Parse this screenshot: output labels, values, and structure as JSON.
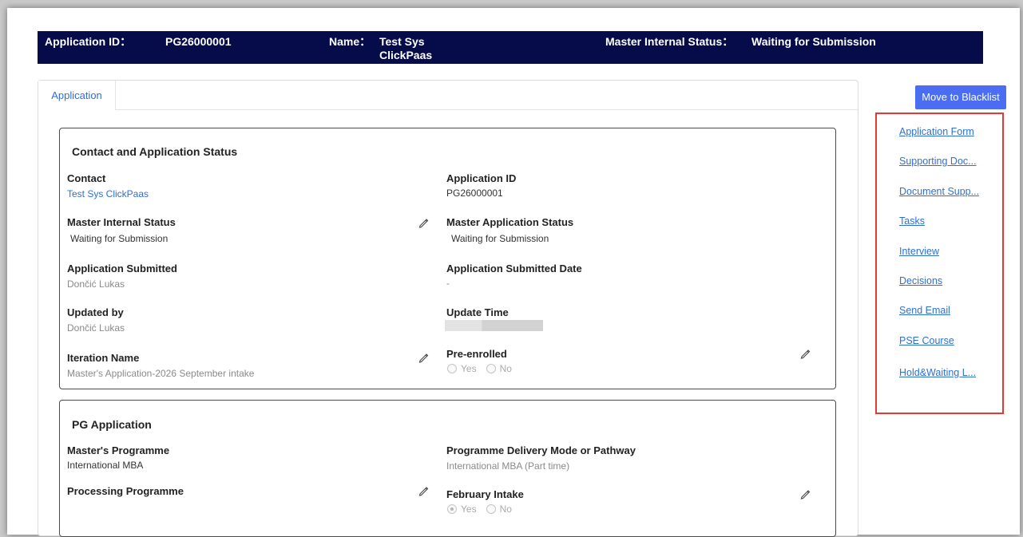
{
  "header": {
    "app_id_label": "Application ID：",
    "app_id_value": "PG26000001",
    "name_label": "Name：",
    "name_value_line1": "Test Sys",
    "name_value_line2": "ClickPaas",
    "status_label": "Master Internal Status：",
    "status_value": "Waiting for Submission"
  },
  "tabs": [
    {
      "label": "Application"
    }
  ],
  "contact_section": {
    "title": "Contact and Application Status",
    "contact_label": "Contact",
    "contact_value": "Test Sys ClickPaas",
    "application_id_label": "Application ID",
    "application_id_value": "PG26000001",
    "master_internal_status_label": "Master Internal Status",
    "master_internal_status_value": "Waiting for Submission",
    "master_application_status_label": "Master Application Status",
    "master_application_status_value": "Waiting for Submission",
    "application_submitted_label": "Application Submitted",
    "application_submitted_value": "Dončić Lukas",
    "application_submitted_date_label": "Application Submitted Date",
    "application_submitted_date_value": "-",
    "updated_by_label": "Updated by",
    "updated_by_value": "Dončić Lukas",
    "update_time_label": "Update Time",
    "iteration_name_label": "Iteration Name",
    "iteration_name_value": "Master's Application-2026 September intake",
    "pre_enrolled_label": "Pre-enrolled",
    "pre_enrolled_yes": "Yes",
    "pre_enrolled_no": "No"
  },
  "pg_section": {
    "title": "PG Application",
    "masters_programme_label": "Master's Programme",
    "masters_programme_value": "International MBA",
    "delivery_mode_label": "Programme Delivery Mode or Pathway",
    "delivery_mode_value": "International MBA (Part time)",
    "processing_programme_label": "Processing Programme",
    "february_intake_label": "February Intake",
    "february_intake_yes": "Yes",
    "february_intake_no": "No"
  },
  "actions": {
    "blacklist_label": "Move to Blacklist"
  },
  "side_links": [
    {
      "label": "Application Form"
    },
    {
      "label": "Supporting Doc..."
    },
    {
      "label": "Document Supp..."
    },
    {
      "label": "Tasks"
    },
    {
      "label": "Interview"
    },
    {
      "label": "Decisions"
    },
    {
      "label": "Send Email"
    },
    {
      "label": "PSE Course"
    },
    {
      "label": "Hold&Waiting L..."
    }
  ],
  "colors": {
    "header_bg": "#060b4a",
    "link": "#2f6fd6",
    "button_bg": "#4a6df2",
    "highlight_border": "#e53935"
  }
}
